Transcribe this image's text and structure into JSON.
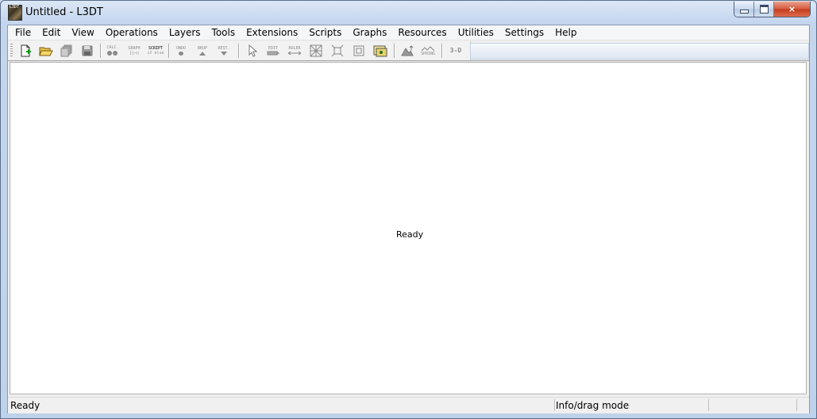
{
  "window": {
    "title": "Untitled - L3DT",
    "icon_text": "L3DT",
    "controls": {
      "minimize": "minimize-icon",
      "maximize": "maximize-icon",
      "close": "×"
    }
  },
  "menu": [
    "File",
    "Edit",
    "View",
    "Operations",
    "Layers",
    "Tools",
    "Extensions",
    "Scripts",
    "Graphs",
    "Resources",
    "Utilities",
    "Settings",
    "Help"
  ],
  "toolbar": {
    "calc": "CALC.",
    "graph": "GRAPH",
    "graph_sub": "[□→□",
    "script": "SCRIPT",
    "script_sub": "if else",
    "undo": "UNDO",
    "bkup": "BKUP",
    "rest": "REST.",
    "edit": "EDIT",
    "ruler": "RULER",
    "spring": "SPRING",
    "three_d": "3-D"
  },
  "canvas": {
    "message": "Ready"
  },
  "statusbar": {
    "left": "Ready",
    "mode": "Info/drag mode"
  }
}
